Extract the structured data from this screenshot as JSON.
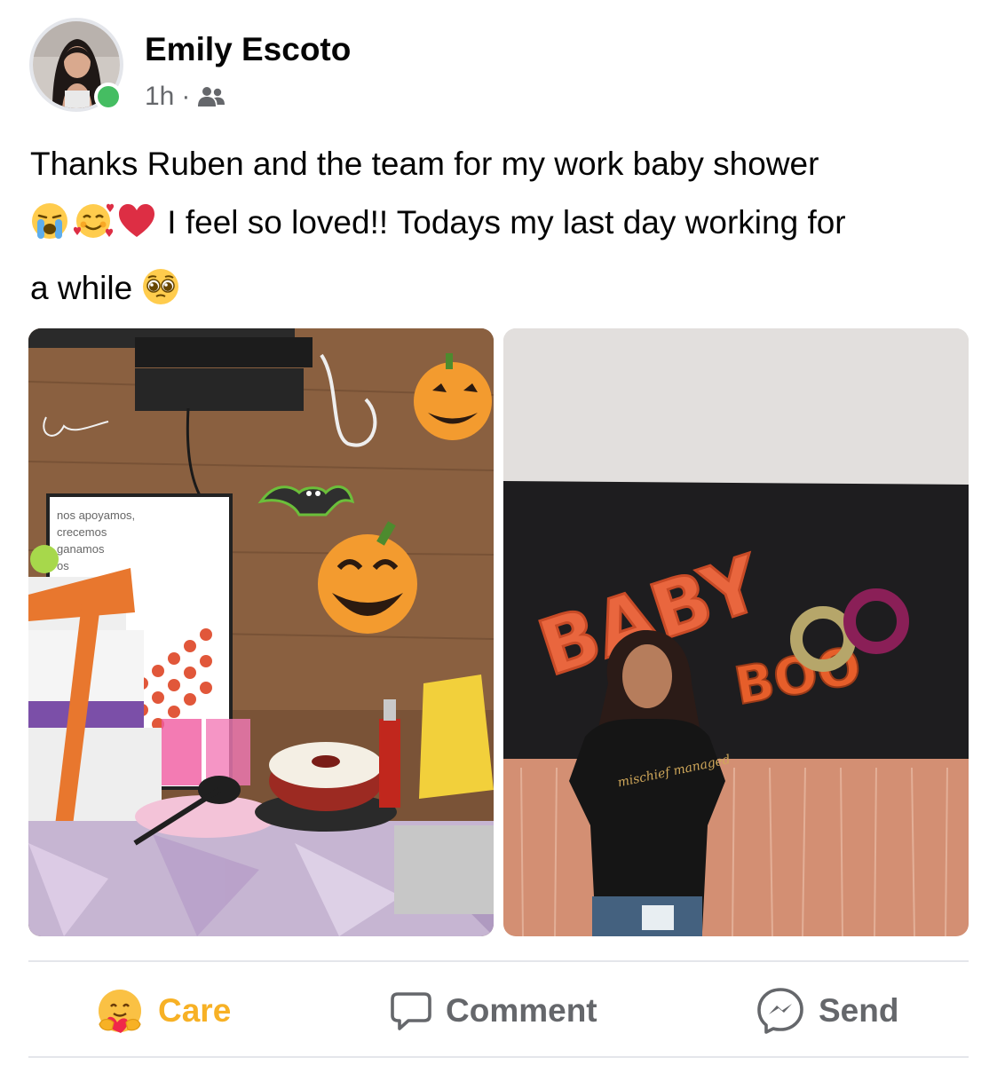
{
  "post": {
    "author_name": "Emily Escoto",
    "timestamp": "1h",
    "separator": "·",
    "audience_icon": "friends-icon",
    "text_lines": [
      "Thanks Ruben and the team for my work baby shower",
      "I feel so loved!! Todays my last day working for",
      "a while"
    ],
    "emojis": [
      "crying-face",
      "smiling-face-with-hearts",
      "red-heart",
      "pleading-face"
    ],
    "online": true
  },
  "photos": {
    "left": {
      "sign_lines": [
        "nos apoyamos,",
        "crecemos",
        "ganamos",
        "os"
      ]
    },
    "right": {
      "balloon_word_top": "BABY",
      "balloon_word_bottom": "BOO",
      "shirt_text": "mischief managed"
    }
  },
  "actions": {
    "care_label": "Care",
    "comment_label": "Comment",
    "send_label": "Send"
  },
  "colors": {
    "care_active": "#f7b125",
    "secondary_text": "#65676b",
    "online_green": "#45bd62"
  }
}
